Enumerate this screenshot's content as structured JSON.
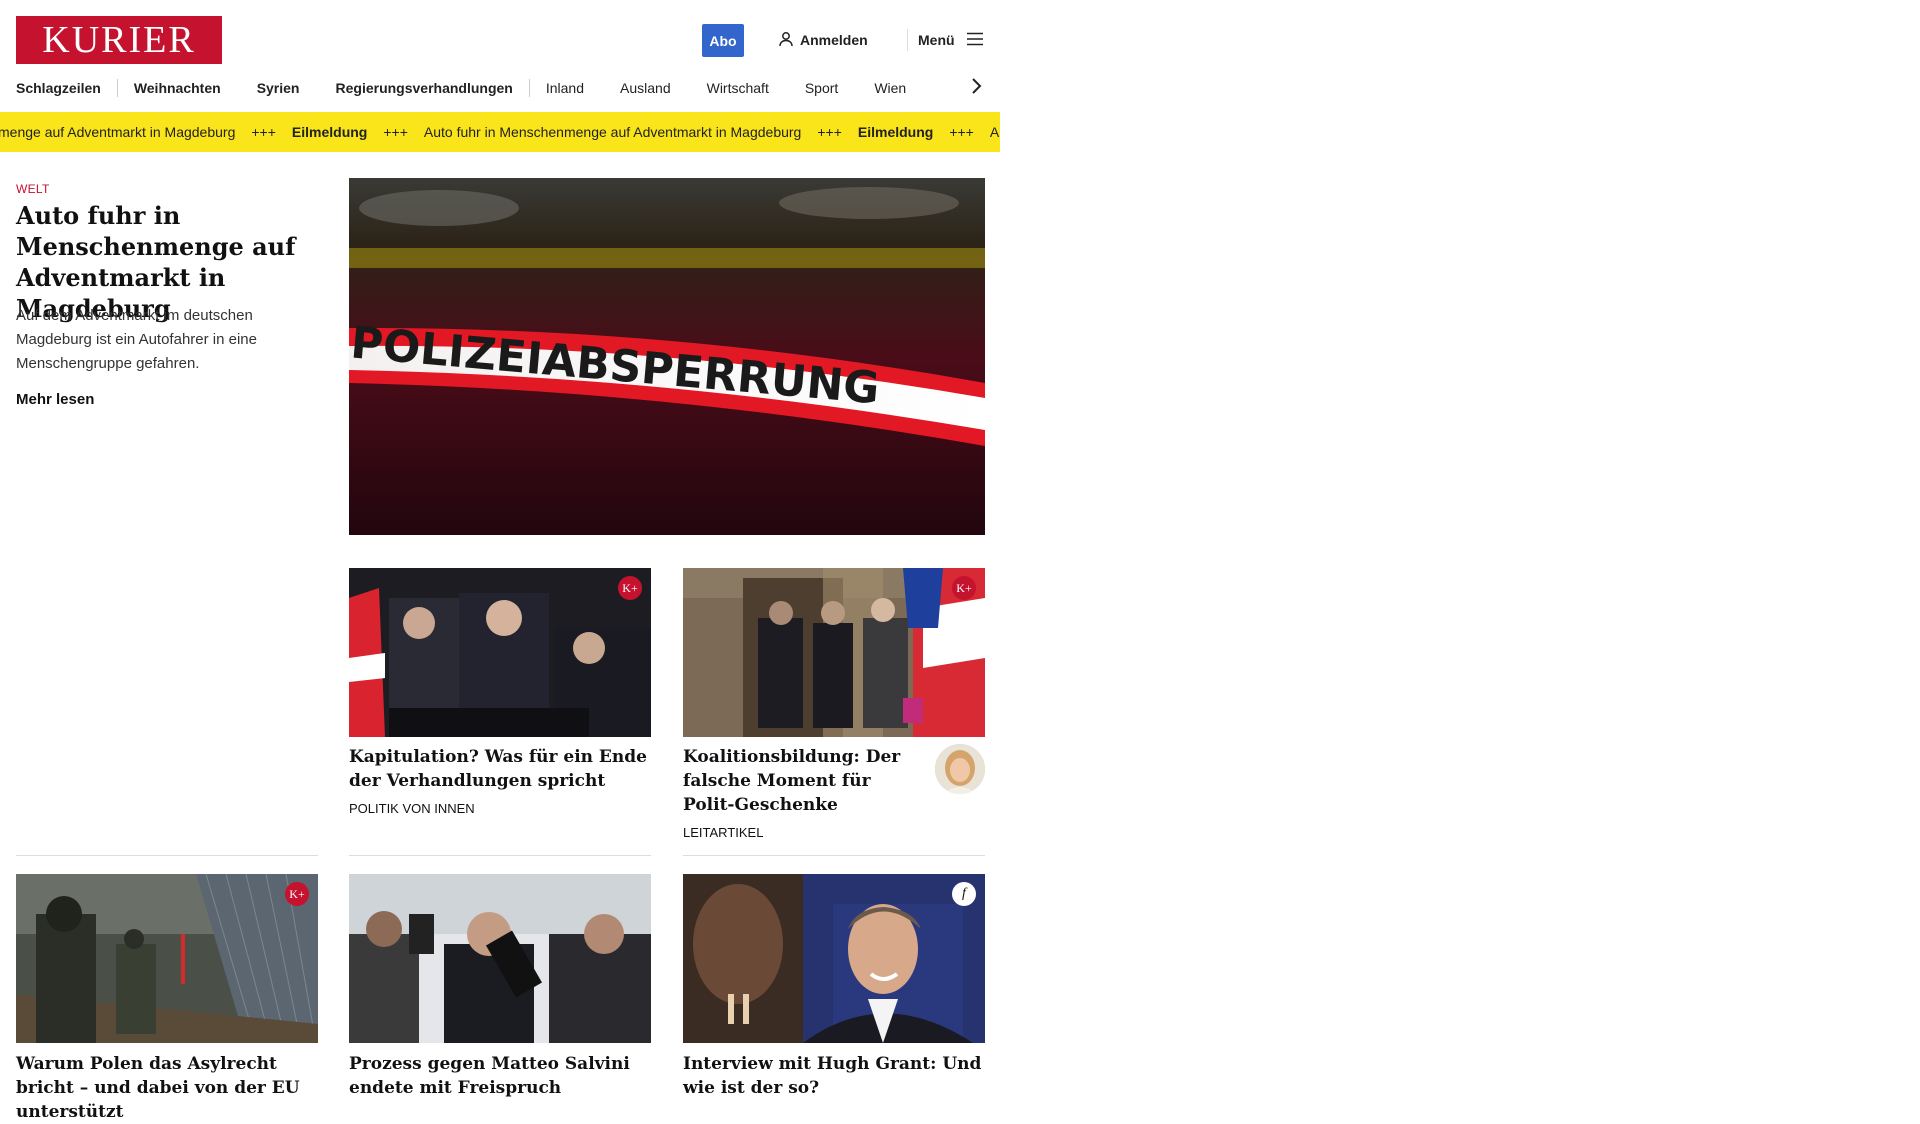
{
  "header": {
    "logo_text": "KURIER",
    "abo_label": "Abo",
    "login_label": "Anmelden",
    "menu_label": "Menü"
  },
  "nav": {
    "items": [
      "Schlagzeilen",
      "Weihnachten",
      "Syrien",
      "Regierungsverhandlungen",
      "Inland",
      "Ausland",
      "Wirtschaft",
      "Sport",
      "Wien"
    ]
  },
  "ticker": {
    "breaking_label": "Eilmeldung",
    "headline": "Auto fuhr in Menschenmenge auf Adventmarkt in Magdeburg",
    "headline_partial_start": "menge auf Adventmarkt in Magdeburg",
    "headline_partial_end": "Auto fuhr in",
    "separator": "+++"
  },
  "lead": {
    "kicker": "WELT",
    "title": "Auto fuhr in Menschen­menge auf Adventmarkt in Magdeburg",
    "teaser": "Auf dem Adventmarkt im deutschen Magdeburg ist ein Autofahrer in eine Menschengruppe gefahren.",
    "more_label": "Mehr lesen",
    "image_text": "POLIZEIABSPERRUNG"
  },
  "cards": [
    {
      "title": "Kapitulation? Was für ein Ende der Verhandlungen spricht",
      "tag": "POLITIK VON INNEN",
      "badge": "K+"
    },
    {
      "title": "Koalitionsbildung: Der fal­sche Moment für Polit-Geschenke",
      "tag": "LEITARTIKEL",
      "badge": "K+"
    },
    {
      "title": "Warum Polen das Asylrecht bricht – und dabei von der EU unterstützt",
      "badge": "K+"
    },
    {
      "title": "Prozess gegen Matteo Salvini en­dete mit Freispruch"
    },
    {
      "title": "Interview mit Hugh Grant: Und wie ist der so?",
      "badge": "f"
    }
  ],
  "colors": {
    "brand_red": "#c4122f",
    "abo_blue": "#3366cc",
    "ticker_yellow": "#fae51a"
  }
}
